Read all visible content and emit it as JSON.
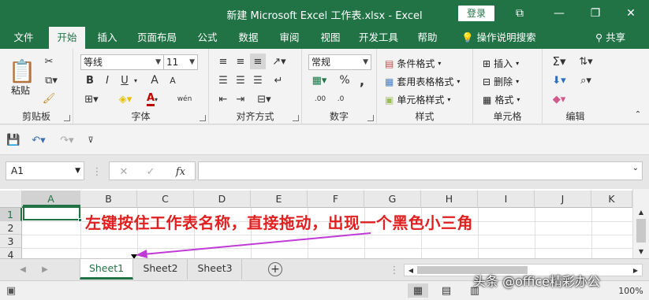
{
  "window": {
    "title": "新建 Microsoft Excel 工作表.xlsx  -  Excel",
    "login_label": "登录",
    "minimize": "—",
    "restore": "❐",
    "close": "✕",
    "ribbon_display": "⧉"
  },
  "tabs": [
    {
      "label": "文件"
    },
    {
      "label": "开始"
    },
    {
      "label": "插入"
    },
    {
      "label": "页面布局"
    },
    {
      "label": "公式"
    },
    {
      "label": "数据"
    },
    {
      "label": "审阅"
    },
    {
      "label": "视图"
    },
    {
      "label": "开发工具"
    },
    {
      "label": "帮助"
    }
  ],
  "help_search": "操作说明搜索",
  "share": "共享",
  "ribbon": {
    "clipboard": {
      "label": "剪贴板",
      "paste": "粘贴"
    },
    "font": {
      "label": "字体",
      "font_name": "等线",
      "font_size": "11",
      "bold": "B",
      "italic": "I",
      "underline": "U",
      "grow": "A",
      "shrink": "A",
      "font_color_letter": "A",
      "phonetic": "wén"
    },
    "alignment": {
      "label": "对齐方式"
    },
    "number": {
      "label": "数字",
      "format": "常规",
      "percent": "%",
      "comma": ","
    },
    "styles": {
      "label": "样式",
      "conditional": "条件格式",
      "table": "套用表格格式",
      "cell_styles": "单元格样式"
    },
    "cells": {
      "label": "单元格",
      "insert": "插入",
      "delete": "删除",
      "format": "格式"
    },
    "editing": {
      "label": "编辑"
    }
  },
  "namebox": "A1",
  "fx": "fx",
  "columns": [
    "A",
    "B",
    "C",
    "D",
    "E",
    "F",
    "G",
    "H",
    "I",
    "J",
    "K"
  ],
  "rows": [
    "1",
    "2",
    "3",
    "4"
  ],
  "annotation": "左键按住工作表名称，直接拖动，出现一个黑色小三角",
  "sheets": [
    {
      "label": "Sheet1"
    },
    {
      "label": "Sheet2"
    },
    {
      "label": "Sheet3"
    }
  ],
  "add_sheet": "+",
  "watermark": "头条 @office精彩办公",
  "zoom": "100%",
  "colors": {
    "accent": "#217346",
    "annotation": "#e02020",
    "arrow": "#c03bd6"
  }
}
